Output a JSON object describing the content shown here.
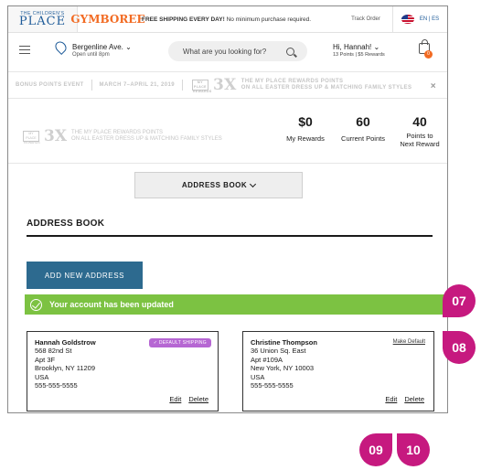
{
  "topbar": {
    "tcp_small": "THE CHILDREN'S",
    "tcp_big": "PLACE",
    "gymboree": "GYMBOREE",
    "shipping_bold": "FREE SHIPPING EVERY DAY!",
    "shipping_rest": " No minimum purchase required.",
    "track_order": "Track Order",
    "language": "EN | ES"
  },
  "header": {
    "store_name": "Bergenline Ave.",
    "store_hours": "Open until 8pm",
    "search_placeholder": "What are you looking for?",
    "greeting": "Hi, Hannah!",
    "points_summary": "13 Points  |  $5 Rewards",
    "bag_count": "0"
  },
  "promo": {
    "event": "BONUS POINTS EVENT",
    "dates": "MARCH 7–APRIL 21, 2019",
    "logo_text": "MY PLACE REWARDS",
    "multiplier": "3X",
    "line1": "THE MY PLACE REWARDS POINTS",
    "line2": "ON ALL EASTER DRESS UP & MATCHING FAMILY STYLES",
    "close": "×"
  },
  "rewards": {
    "my_rewards_value": "$0",
    "my_rewards_label": "My Rewards",
    "current_points_value": "60",
    "current_points_label": "Current Points",
    "next_reward_value": "40",
    "next_reward_label_1": "Points to",
    "next_reward_label_2": "Next Reward"
  },
  "address_book_dropdown": "ADDRESS BOOK",
  "section_title": "ADDRESS BOOK",
  "add_button": "ADD NEW ADDRESS",
  "success_message": "Your account has been updated",
  "addresses": [
    {
      "name": "Hannah Goldstrow",
      "line1": "568 82nd St",
      "line2": "Apt 3F",
      "city": "Brooklyn, NY 11209",
      "country": "USA",
      "phone": "555-555-5555",
      "badge": "✓ DEFAULT SHIPPING",
      "edit": "Edit",
      "delete": "Delete"
    },
    {
      "name": "Christine Thompson",
      "line1": "36 Union Sq. East",
      "line2": "Apt #109A",
      "city": "New York, NY 10003",
      "country": "USA",
      "phone": "555-555-5555",
      "make_default": "Make Default",
      "edit": "Edit",
      "delete": "Delete"
    }
  ],
  "markers": {
    "m07": "07",
    "m08": "08",
    "m09": "09",
    "m10": "10"
  },
  "colors": {
    "success_green": "#7cc242",
    "button_blue": "#2d6a8f",
    "marker_magenta": "#c6197f",
    "badge_purple": "#b667d3",
    "gymboree_orange": "#f26b23"
  }
}
